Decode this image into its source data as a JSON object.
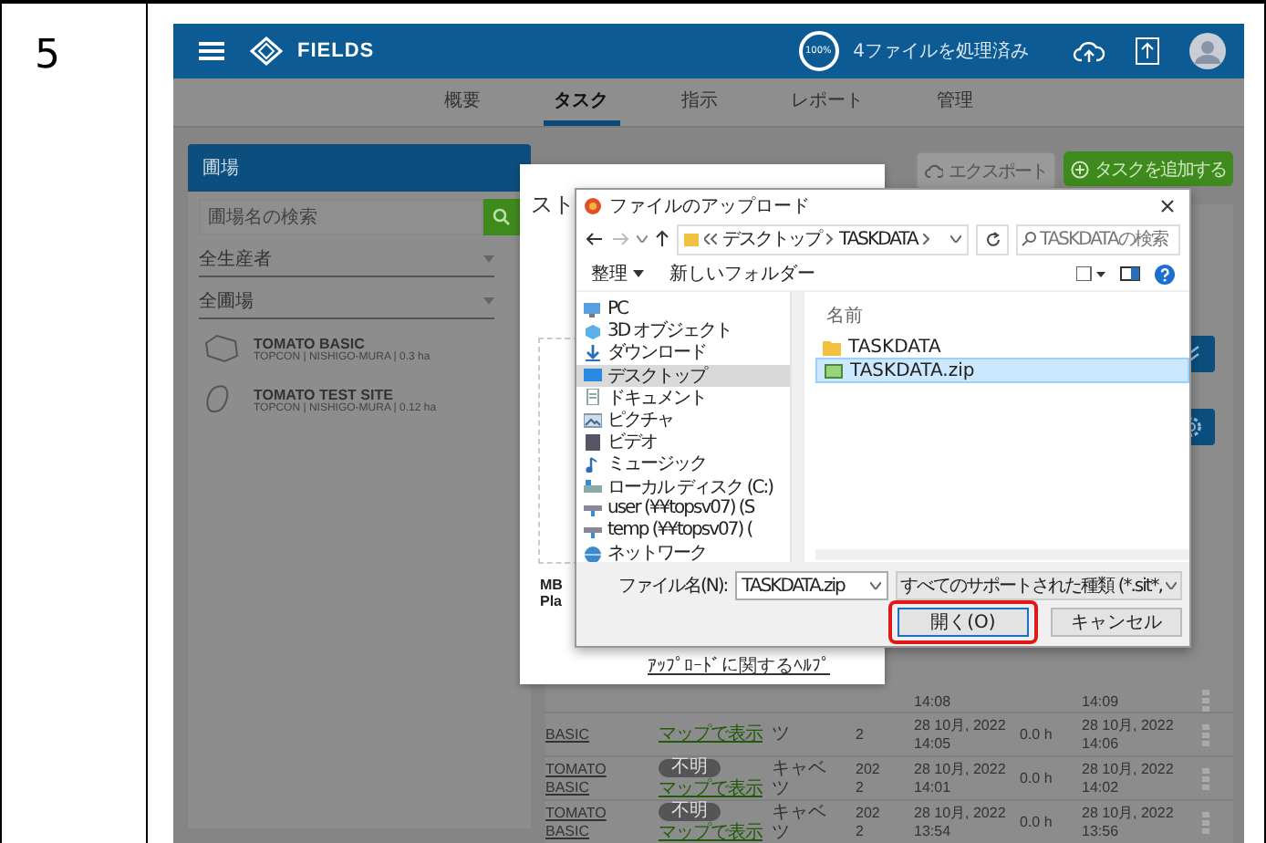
{
  "step_number": "5",
  "app": {
    "title": "FIELDS",
    "progress": "100%",
    "status": "4ファイルを処理済み"
  },
  "nav_tabs": [
    {
      "label": "概要",
      "selected": false
    },
    {
      "label": "タスク",
      "selected": true
    },
    {
      "label": "指示",
      "selected": false
    },
    {
      "label": "レポート",
      "selected": false
    },
    {
      "label": "管理",
      "selected": false
    }
  ],
  "sidebar": {
    "title": "圃場",
    "search": {
      "placeholder": "圃場名の検索"
    },
    "filters": [
      "全生産者",
      "全圃場"
    ],
    "fields": [
      {
        "name": "TOMATO BASIC",
        "details": "TOPCON | NISHIGO-MURA | 0.3 ha",
        "kind": "polygon"
      },
      {
        "name": "TOMATO TEST SITE",
        "details": "TOPCON | NISHIGO-MURA | 0.12 ha",
        "kind": "oval"
      }
    ]
  },
  "toolbar": [
    {
      "label": "エクスポート",
      "disabled": true
    },
    {
      "label": "タスクを追加する",
      "disabled": false
    }
  ],
  "tasks": [
    {
      "start": "14:08",
      "end": "14:09"
    },
    {
      "name": "BASIC",
      "map_link": "マップで表示",
      "crop": "ツ",
      "year": "2",
      "start": "28 10月, 2022 14:05",
      "duration": "0.0 h",
      "end": "28 10月, 2022 14:06"
    },
    {
      "name": "TOMATO BASIC",
      "status": "不明",
      "map_link": "マップで表示",
      "crop": "キャベツ",
      "year": "2022",
      "start": "28 10月, 2022 14:01",
      "duration": "0.0 h",
      "end": "28 10月, 2022 14:02"
    },
    {
      "name": "TOMATO BASIC",
      "status": "不明",
      "map_link": "マップで表示",
      "crop": "キャベツ",
      "year": "2022",
      "start": "28 10月, 2022 13:54",
      "duration": "0.0 h",
      "end": "28 10月, 2022 13:56"
    }
  ],
  "import_modal": {
    "title": "スト",
    "size_note": "MB",
    "plan_note": "Pla",
    "help_link": "ｱｯﾌﾟﾛｰﾄﾞに関するﾍﾙﾌﾟ"
  },
  "file_dialog": {
    "title": "ファイルのアップロード",
    "path": [
      "デスクトップ",
      "TASKDATA"
    ],
    "search": {
      "placeholder": "TASKDATAの検索"
    },
    "commands": [
      "整理",
      "新しいフォルダー"
    ],
    "nav_items": [
      {
        "label": "PC",
        "kind": "pc",
        "selected": false
      },
      {
        "label": "3D オブジェクト",
        "kind": "cube",
        "selected": false
      },
      {
        "label": "ダウンロード",
        "kind": "download",
        "selected": false
      },
      {
        "label": "デスクトップ",
        "kind": "desktop",
        "selected": true
      },
      {
        "label": "ドキュメント",
        "kind": "document",
        "selected": false
      },
      {
        "label": "ピクチャ",
        "kind": "picture",
        "selected": false
      },
      {
        "label": "ビデオ",
        "kind": "video",
        "selected": false
      },
      {
        "label": "ミュージック",
        "kind": "music",
        "selected": false
      },
      {
        "label": "ローカル ディスク (C:)",
        "kind": "disk",
        "selected": false
      },
      {
        "label": "user (¥¥topsv07) (S",
        "kind": "netdrive",
        "selected": false
      },
      {
        "label": "temp (¥¥topsv07) (",
        "kind": "netdrive",
        "selected": false
      },
      {
        "label": "ネットワーク",
        "kind": "network",
        "selected": false
      }
    ],
    "column_header": "名前",
    "files": [
      {
        "name": "TASKDATA",
        "kind": "folder",
        "selected": false
      },
      {
        "name": "TASKDATA.zip",
        "kind": "zip",
        "selected": true
      }
    ],
    "file_name": {
      "label": "ファイル名(N):",
      "value": "TASKDATA.zip"
    },
    "file_type": "すべてのサポートされた種類 (*.sit*,",
    "buttons": [
      {
        "label": "開く(O)",
        "highlighted": true
      },
      {
        "label": "キャンセル",
        "highlighted": false
      }
    ]
  }
}
